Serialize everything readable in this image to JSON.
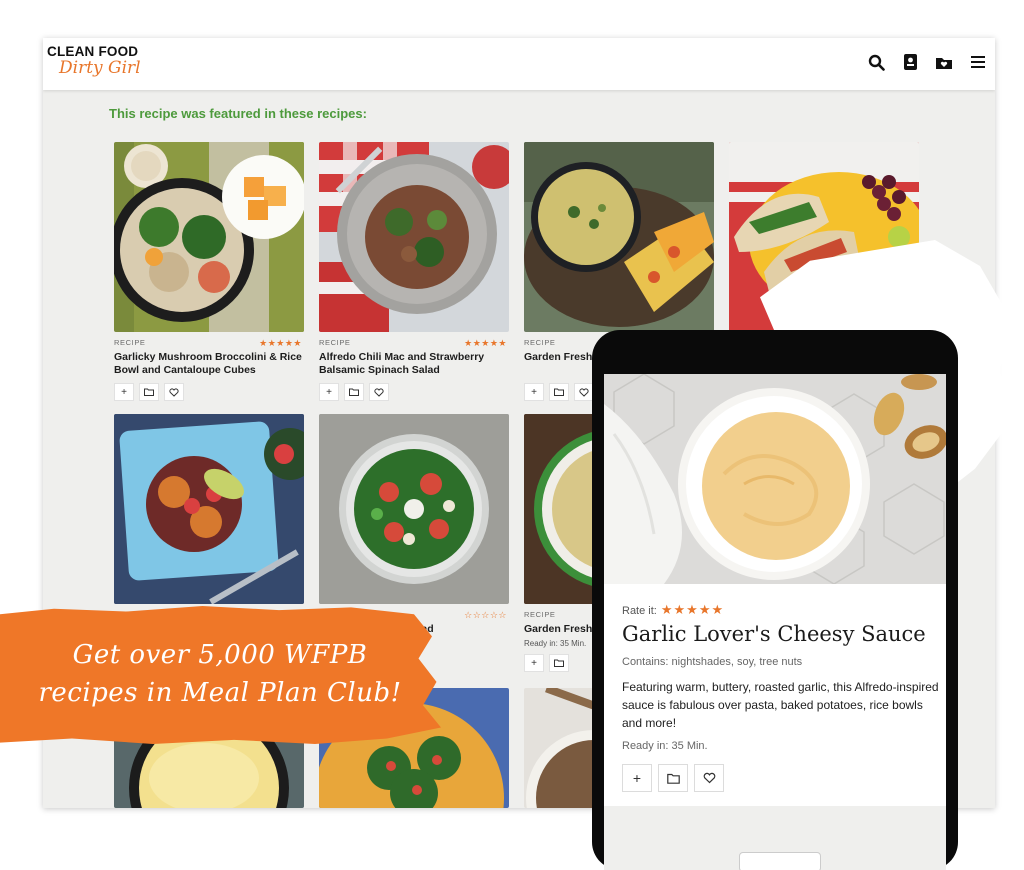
{
  "brand": {
    "line1": "CLEAN FOOD",
    "line2": "Dirty Girl"
  },
  "nav": {
    "icons": [
      "search-icon",
      "recipe-book-icon",
      "folder-heart-icon",
      "menu-icon"
    ]
  },
  "featured_heading": "This recipe was featured in these recipes:",
  "colors": {
    "accent_orange": "#ef7728",
    "heading_green": "#4d9a3c",
    "star_orange": "#e8762b"
  },
  "cards": [
    {
      "label": "RECIPE",
      "stars": "★★★★★",
      "title": "Garlicky Mushroom Broccolini & Rice Bowl and Cantaloupe Cubes",
      "ready": ""
    },
    {
      "label": "RECIPE",
      "stars": "★★★★★",
      "title": "Alfredo Chili Mac and Strawberry Balsamic Spinach Salad",
      "ready": ""
    },
    {
      "label": "RECIPE",
      "stars": "",
      "title": "Garden Fresh Plant-filled Er",
      "ready": ""
    },
    {
      "label": "",
      "stars": "",
      "title": "",
      "ready": ""
    },
    {
      "label": "",
      "stars": "",
      "title": "",
      "ready": ""
    },
    {
      "label": "",
      "stars": "☆☆☆☆☆",
      "title": "Pea Salad",
      "ready": ""
    },
    {
      "label": "RECIPE",
      "stars": "",
      "title": "Garden Fresh",
      "ready": "Ready in: 35 Min."
    }
  ],
  "promo": {
    "line1": "Get over 5,000 WFPB",
    "line2": "recipes in Meal Plan Club!"
  },
  "phone": {
    "rate_label": "Rate it:",
    "stars": "★★★★★",
    "title": "Garlic Lover's Cheesy Sauce",
    "contains": "Contains: nightshades, soy, tree nuts",
    "description": "Featuring warm, buttery, roasted garlic, this Alfredo-inspired sauce is fabulous over pasta, baked potatoes, rice bowls and more!",
    "ready": "Ready in: 35 Min."
  }
}
